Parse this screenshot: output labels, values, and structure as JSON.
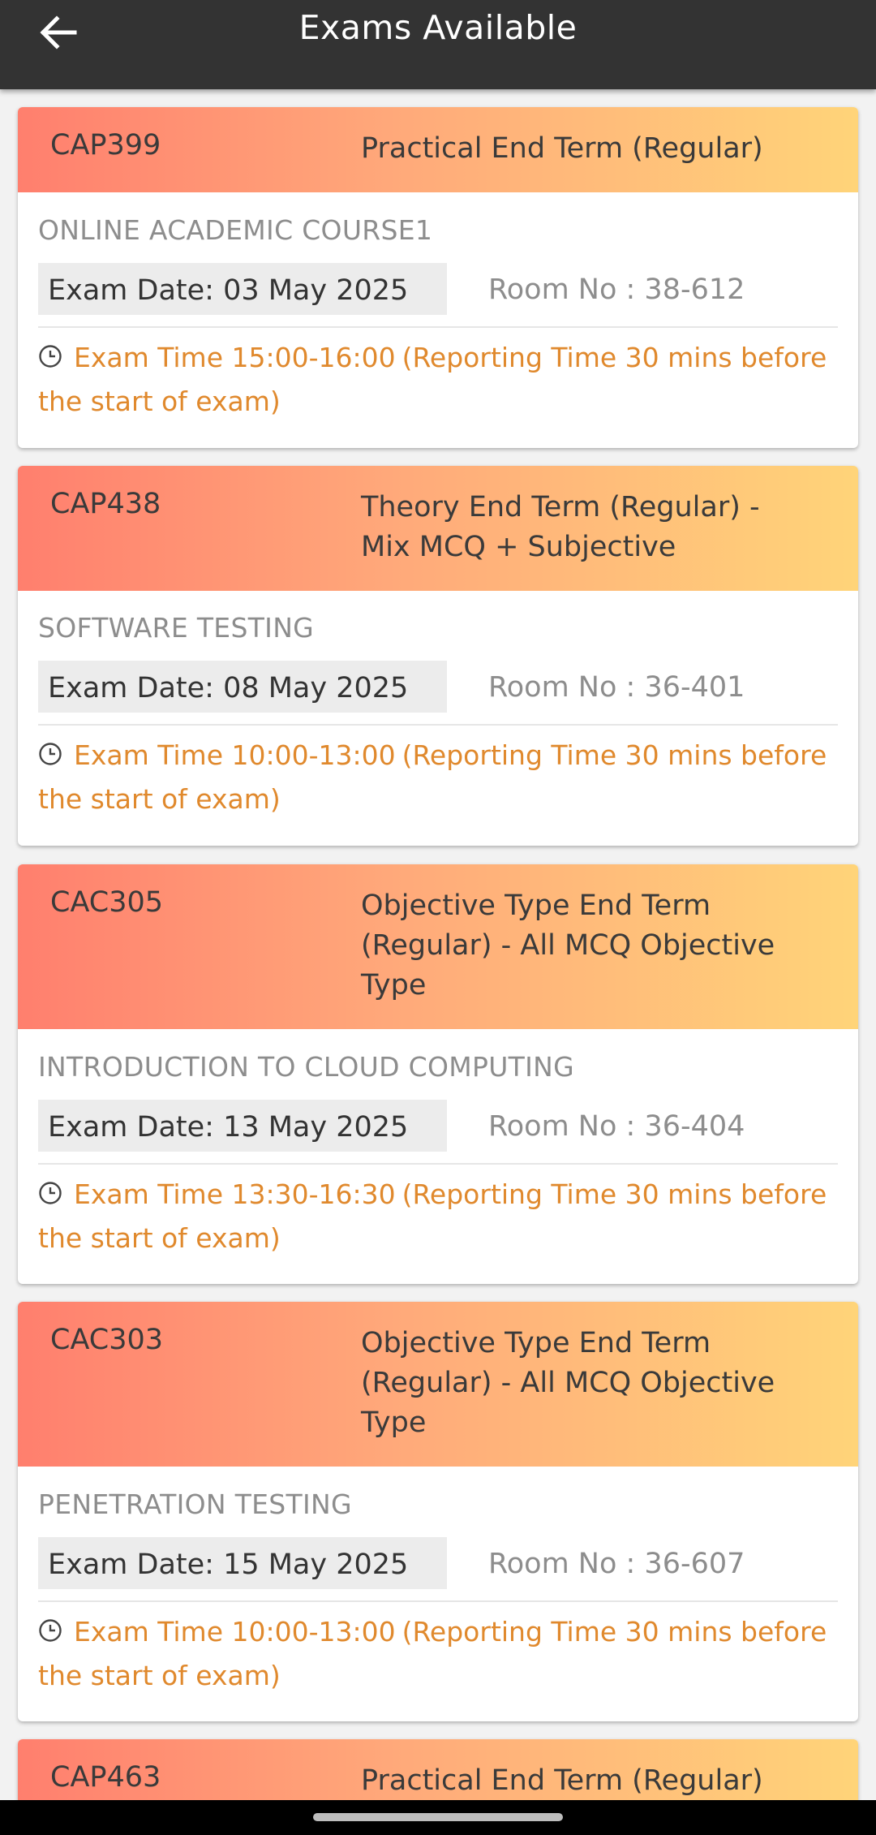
{
  "header": {
    "title": "Exams Available",
    "back_icon": "arrow-left-icon"
  },
  "exams": [
    {
      "code": "CAP399",
      "type": "Practical End Term (Regular)",
      "course": "ONLINE ACADEMIC COURSE1",
      "date": "Exam Date: 03 May 2025",
      "room": "Room No : 38-612",
      "time": "Exam Time 15:00-16:00",
      "reporting": "(Reporting Time 30 mins before the start of exam)"
    },
    {
      "code": "CAP438",
      "type": "Theory End Term (Regular) - Mix MCQ + Subjective",
      "course": "SOFTWARE TESTING",
      "date": "Exam Date: 08 May 2025",
      "room": "Room No : 36-401",
      "time": "Exam Time 10:00-13:00",
      "reporting": "(Reporting Time 30 mins before the start of exam)"
    },
    {
      "code": "CAC305",
      "type": "Objective Type End Term (Regular) - All MCQ Objective Type",
      "course": "INTRODUCTION TO CLOUD COMPUTING",
      "date": "Exam Date: 13 May 2025",
      "room": "Room No : 36-404",
      "time": "Exam Time 13:30-16:30",
      "reporting": "(Reporting Time 30 mins before the start of exam)"
    },
    {
      "code": "CAC303",
      "type": "Objective Type End Term (Regular) - All MCQ Objective Type",
      "course": "PENETRATION TESTING",
      "date": "Exam Date: 15 May 2025",
      "room": "Room No : 36-607",
      "time": "Exam Time 10:00-13:00",
      "reporting": "(Reporting Time 30 mins before the start of exam)"
    },
    {
      "code": "CAP463",
      "type": "Practical End Term (Regular)"
    }
  ],
  "colors": {
    "appbar": "#333333",
    "header_gradient_start": "#ff7f6e",
    "header_gradient_end": "#ffd479",
    "time_text": "#e0892d",
    "muted_text": "#8d8d8d"
  }
}
